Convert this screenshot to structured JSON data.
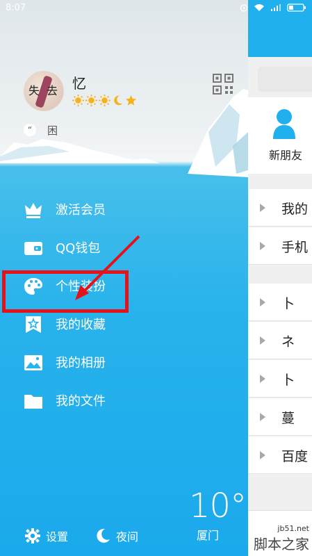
{
  "status_bar": {
    "time": "8:07"
  },
  "profile": {
    "nickname": "忆",
    "avatar_text_left": "失",
    "avatar_text_right": "去",
    "signature": "困",
    "quote_mark": "“"
  },
  "menu": [
    {
      "label": "激活会员",
      "icon": "crown-icon"
    },
    {
      "label": "QQ钱包",
      "icon": "wallet-icon"
    },
    {
      "label": "个性装扮",
      "icon": "palette-icon"
    },
    {
      "label": "我的收藏",
      "icon": "star-bookmark-icon"
    },
    {
      "label": "我的相册",
      "icon": "photo-icon"
    },
    {
      "label": "我的文件",
      "icon": "folder-icon"
    }
  ],
  "bottom": {
    "settings": "设置",
    "night": "夜间"
  },
  "weather": {
    "temp": "10°",
    "city": "厦门"
  },
  "right_panel": {
    "new_friend": "新朋友",
    "rows": [
      "我的",
      "手机",
      "卜",
      "ネ",
      "卜",
      "蔓",
      "百度"
    ]
  },
  "watermark": {
    "site": "jb51.net",
    "name": "脚本之家"
  },
  "colors": {
    "highlight": "#e3121b",
    "drawer_blue": "#1aa9ec",
    "accent": "#1fb0ed"
  }
}
